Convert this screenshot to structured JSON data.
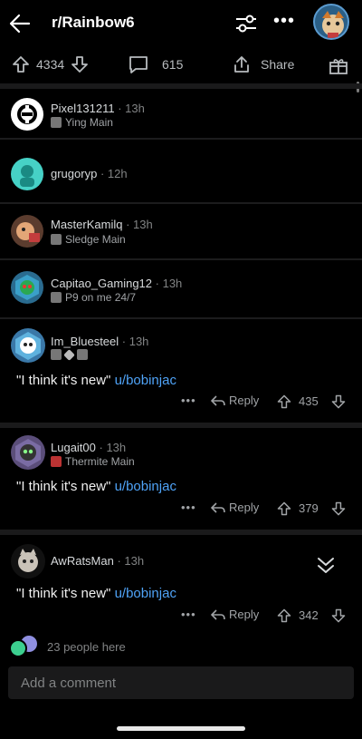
{
  "header": {
    "title": "r/Rainbow6",
    "back_icon": "arrow-left-icon",
    "filter_icon": "sliders-icon",
    "more_icon": "more-horizontal-icon",
    "more_label": "•••"
  },
  "actionbar": {
    "upvotes": "4334",
    "comments": "615",
    "share_label": "Share"
  },
  "comments": [
    {
      "user": "Pixel131211",
      "time": "· 13h",
      "flair": "Ying Main"
    },
    {
      "user": "grugoryp",
      "time": "· 12h",
      "flair": ""
    },
    {
      "user": "MasterKamilq",
      "time": "· 13h",
      "flair": "Sledge Main"
    },
    {
      "user": "Capitao_Gaming12",
      "time": "· 13h",
      "flair": "P9 on me 24/7"
    },
    {
      "user": "Im_Bluesteel",
      "time": "· 13h",
      "flair": "",
      "text": "\"I think it's new\"",
      "mention": "u/bobinjac",
      "reply": "Reply",
      "score": "435"
    },
    {
      "user": "Lugait00",
      "time": "· 13h",
      "flair": "Thermite Main",
      "text": "\"I think it's new\"",
      "mention": "u/bobinjac",
      "reply": "Reply",
      "score": "379"
    },
    {
      "user": "AwRatsMan",
      "time": "· 13h",
      "flair": "",
      "text": "\"I think it's new\"",
      "mention": "u/bobinjac",
      "reply": "Reply",
      "score": "342"
    }
  ],
  "presence": {
    "text": "23 people here"
  },
  "composer": {
    "placeholder": "Add a comment"
  },
  "colors": {
    "background": "#000000",
    "link": "#4fa3f7",
    "muted": "#818384"
  }
}
